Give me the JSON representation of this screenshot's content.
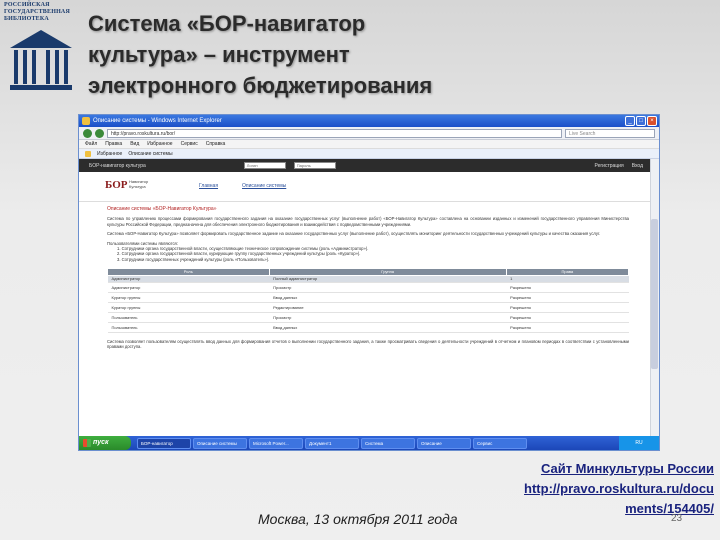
{
  "logo": {
    "lines": [
      "РОССИЙСКАЯ",
      "ГОСУДАРСТВЕННАЯ",
      "БИБЛИОТЕКА"
    ]
  },
  "slide": {
    "title_lines": [
      "Система «БОР-навигатор",
      "культура» – инструмент",
      "электронного бюджетирования"
    ],
    "source_lines": [
      "Сайт Минкультуры России",
      "http://pravo.roskultura.ru/docu",
      "ments/154405/"
    ],
    "date": "Москва, 13 октября 2011 года",
    "page_number": "23"
  },
  "browser": {
    "window_title": "Описание системы - Windows Internet Explorer",
    "address": "http://pravo.roskultura.ru/bor/",
    "search_placeholder": "Live Search",
    "menu": [
      "Файл",
      "Правка",
      "Вид",
      "Избранное",
      "Сервис",
      "Справка"
    ],
    "favorites": [
      "Избранное",
      "Описание системы"
    ],
    "colors": {
      "titlebar": "#1b4fc8",
      "taskbar": "#2f63d6",
      "accent": "#b22222"
    }
  },
  "site": {
    "top_label": "БОР-навигатор культура",
    "login_placeholder": "Логин",
    "password_placeholder": "Пароль",
    "top_right": [
      "Регистрация",
      "Вход"
    ],
    "logo_text": "БОР",
    "logo_subtitle": "Навигатор Культура",
    "nav": [
      "Главная",
      "Описание системы"
    ],
    "heading": "Описание системы «БОР-Навигатор Культура»",
    "paragraphs": [
      "Система по управлению процессами формирования государственного задания на оказание государственных услуг (выполнение работ) «БОР-Навигатор Культура» составлена на основании изданных и изменений государственного управления Министерства культуры Российской Федерации, предназначена для обеспечения электронного бюджетирования и взаимодействия с подведомственными учреждениями.",
      "Система «БОР-Навигатор Культура» позволяет формировать государственное задание на оказание государственных услуг (выполнение работ), осуществлять мониторинг деятельности государственных учреждений культуры и качества оказания услуг."
    ],
    "list_intro": "Пользователями системы являются:",
    "list": [
      "1. Сотрудники органа государственной власти, осуществляющие техническое сопровождение системы (роль «Администратор»).",
      "2. Сотрудники органа государственной власти, курирующие группу государственных учреждений культуры (роль «Куратор»).",
      "3. Сотрудники государственных учреждений культуры (роль «Пользователь»)."
    ],
    "table": {
      "headers": [
        "Роль",
        "Группа",
        "Права"
      ],
      "sub_row": [
        "Администратор",
        "Полный администратор",
        "1"
      ],
      "rows": [
        [
          "Администратор",
          "Просмотр",
          "Разрешено"
        ],
        [
          "Куратор группы",
          "Ввод данных",
          "Разрешено"
        ],
        [
          "Куратор группы",
          "Редактирование",
          "Разрешено"
        ],
        [
          "Пользователь",
          "Просмотр",
          "Разрешено"
        ],
        [
          "Пользователь",
          "Ввод данных",
          "Разрешено"
        ]
      ]
    },
    "closing": "Система позволяет пользователям осуществлять ввод данных для формирования отчетов о выполнении государственного задания, а также просматривать сведения о деятельности учреждений в отчетном и плановом периодах в соответствии с установленными правами доступа."
  },
  "taskbar": {
    "start_label": "пуск",
    "items": [
      "БОР-навигатор",
      "Описание системы",
      "Microsoft Power...",
      "Документ1",
      "Система",
      "Описание",
      "Сервис"
    ],
    "clock": "RU"
  }
}
